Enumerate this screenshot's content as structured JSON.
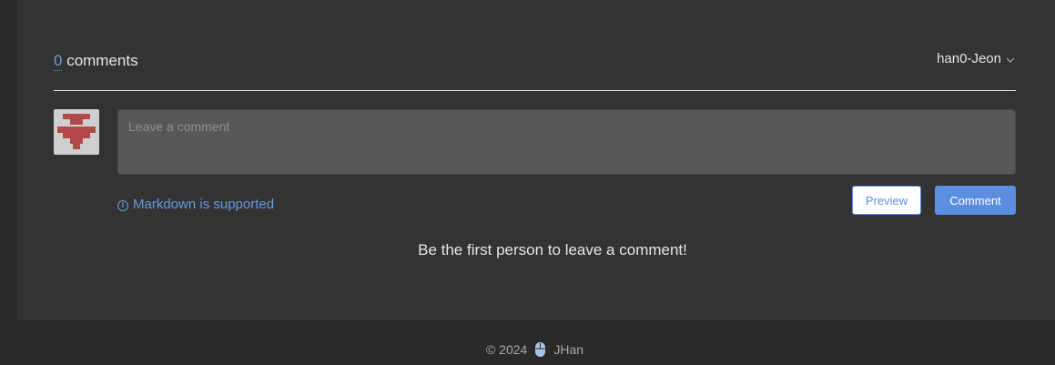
{
  "comments": {
    "count": "0",
    "label": " comments",
    "user": "han0-Jeon",
    "placeholder": "Leave a comment",
    "markdown_note": "Markdown is supported",
    "preview_label": "Preview",
    "comment_label": "Comment",
    "empty_message": "Be the first person to leave a comment!"
  },
  "footer": {
    "copyright": "© 2024",
    "author": "JHan"
  },
  "colors": {
    "accent": "#5b8ee0",
    "avatar_red": "#b34848",
    "avatar_bg": "#cfcfcf"
  },
  "icons": {
    "info": "info-icon",
    "chevron": "chevron-down-icon",
    "footer": "mouse-icon"
  }
}
